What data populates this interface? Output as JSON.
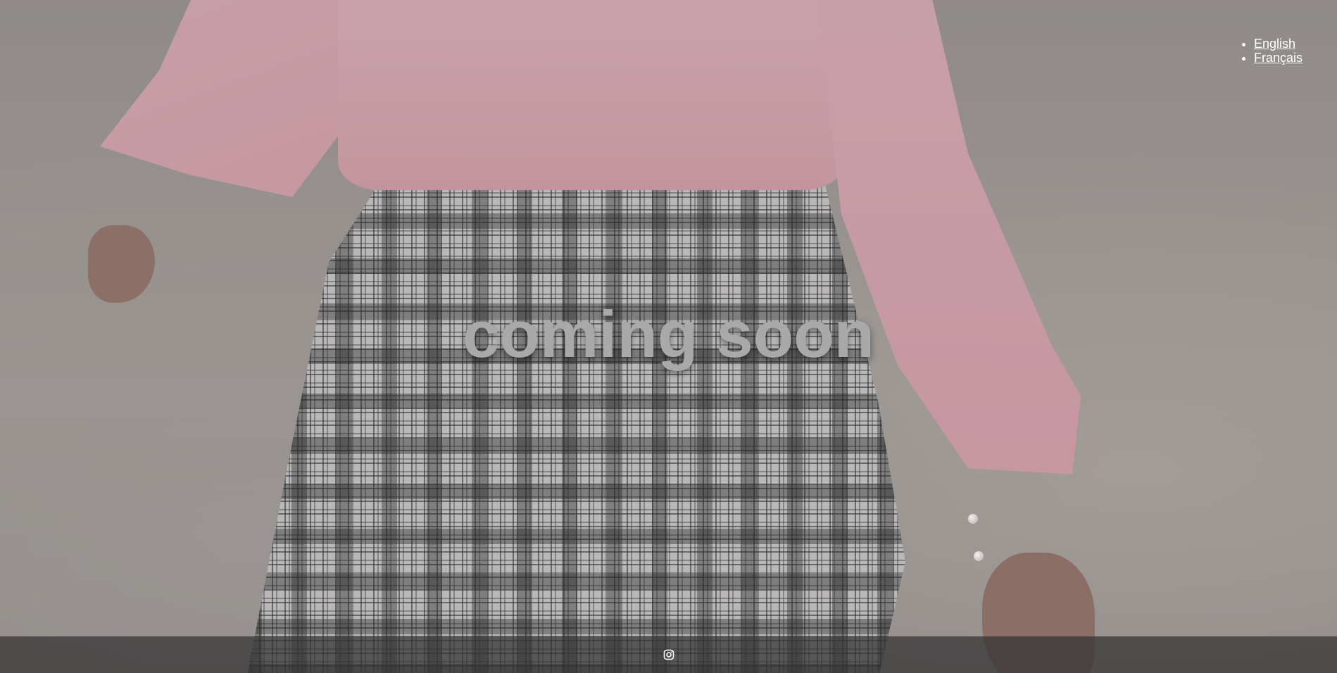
{
  "languages": [
    {
      "label": "English"
    },
    {
      "label": "Français"
    }
  ],
  "headline": "coming soon",
  "footer": {
    "social": [
      {
        "icon": "instagram-icon"
      }
    ]
  },
  "colors": {
    "overlay_tint": "#8f8c8a",
    "headline": "#a9a9a9",
    "footer_bar": "#323232",
    "link": "#ffffff"
  }
}
